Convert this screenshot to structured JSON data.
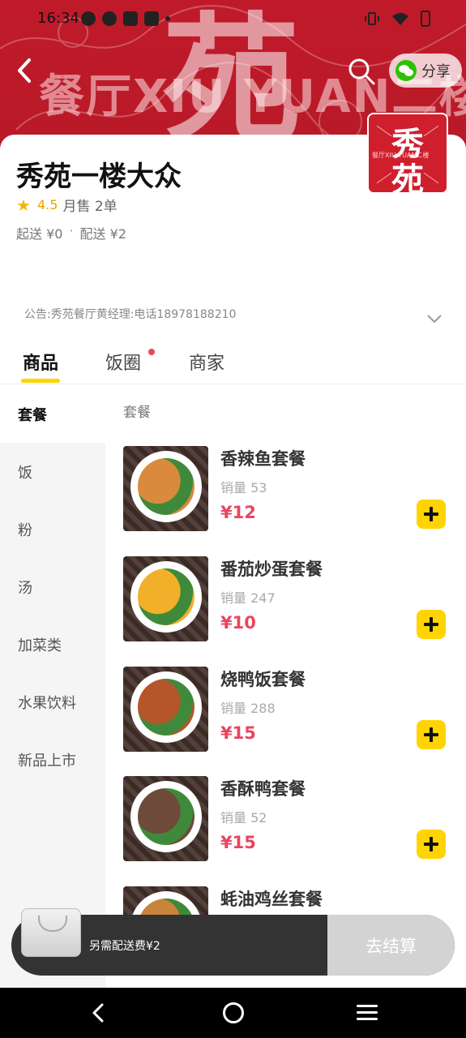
{
  "status_bar": {
    "time": "16:34"
  },
  "banner": {
    "watermark_text": "餐厅XIU YUAN二楼",
    "big_char": "苑"
  },
  "header": {
    "share_label": "分享"
  },
  "logo": {
    "char1": "秀",
    "char2": "苑",
    "subtitle": "餐厅XIU YUAN二楼"
  },
  "shop": {
    "name": "秀苑一楼大众",
    "rating": "4.5",
    "monthly_sales": "月售 2单",
    "min_order": "起送 ¥0",
    "delivery_fee": "配送 ¥2",
    "separator": "·",
    "notice": "公告:秀苑餐厅黄经理:电话18978188210"
  },
  "tabs": [
    {
      "label": "商品",
      "active": true
    },
    {
      "label": "饭圈",
      "has_dot": true
    },
    {
      "label": "商家"
    }
  ],
  "sidebar": {
    "items": [
      {
        "label": "套餐",
        "active": true
      },
      {
        "label": "饭"
      },
      {
        "label": "粉"
      },
      {
        "label": "汤"
      },
      {
        "label": "加菜类"
      },
      {
        "label": "水果饮料"
      },
      {
        "label": "新品上市"
      }
    ]
  },
  "section": {
    "title": "套餐"
  },
  "products": [
    {
      "name": "香辣鱼套餐",
      "sold": "销量 53",
      "price": "¥12",
      "food_color": "#d98a3c"
    },
    {
      "name": "番茄炒蛋套餐",
      "sold": "销量 247",
      "price": "¥10",
      "food_color": "#f2b02a"
    },
    {
      "name": "烧鸭饭套餐",
      "sold": "销量 288",
      "price": "¥15",
      "food_color": "#b5562a"
    },
    {
      "name": "香酥鸭套餐",
      "sold": "销量 52",
      "price": "¥15",
      "food_color": "#6e4a3a"
    },
    {
      "name": "蚝油鸡丝套餐",
      "sold": "",
      "price": "",
      "food_color": "#c8843a"
    }
  ],
  "cart": {
    "fee_note": "另需配送费¥2",
    "checkout_label": "去结算"
  },
  "colors": {
    "brand_red": "#c01a2a",
    "accent_yellow": "#ffd400",
    "price_red": "#e8465f"
  }
}
